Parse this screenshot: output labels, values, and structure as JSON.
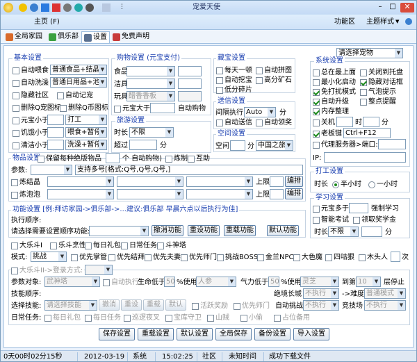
{
  "title": "宠爱天使",
  "menu": {
    "home": "主页 (F)",
    "function_area": "功能区",
    "theme": "主题样式",
    "theme_arrow": "▼"
  },
  "tabs": [
    "全局家园",
    "俱乐部",
    "设置",
    "免费声明"
  ],
  "basic": {
    "title": "基本设置",
    "auto_feed": "自动喂食",
    "feed_sel": "普通食品+结晶",
    "auto_wash": "自动洗澡",
    "wash_sel": "普通日用品+池",
    "hide_community": "隐藏社区",
    "auto_clean": "自动记宠",
    "del_qq_icon": "删除Q宠图标",
    "del_q_coin_icon": "删除Q币图标",
    "yuanbao_lt": "元宝小于",
    "yuanbao_sel": "打工",
    "hunger_lt": "饥饿小于",
    "hunger_sel": "喂食+暂停",
    "clean_lt": "清洁小于",
    "clean_sel": "洗澡+暂停"
  },
  "shop": {
    "title": "购物设置 (元宝支付)",
    "food": "食品",
    "clean": "洁具",
    "toy": "玩具",
    "toy_sel": "醋香香板",
    "yuanbao_gt": "元宝大于",
    "auto_buy": "自动购物"
  },
  "travel": {
    "title": "旅游设置",
    "duration": "时长",
    "duration_sel": "不限",
    "over": "超过",
    "minutes": "分"
  },
  "treasure": {
    "title": "藏宝设置",
    "daily": "每天一顿",
    "auto_puzzle": "自动拼图",
    "auto_dig": "自动挖宝",
    "high_ore": "高分矿石",
    "low_fragment": "低分碎片"
  },
  "gift": {
    "title": "送信设置",
    "interval": "间隔执行:",
    "interval_sel": "Auto",
    "min": "分",
    "auto_send": "自动送信",
    "auto_receive": "自动领奖"
  },
  "space": {
    "title": "空间设置",
    "space": "空间",
    "min": "分",
    "space_sel": "中国之旅"
  },
  "pet": {
    "select": "请选择宠物"
  },
  "sys": {
    "title": "系统设置",
    "topmost": "总在最上面",
    "close_tray": "关闭到托盘",
    "min_start": "最小化启动",
    "hide_dialog": "隐藏对话框",
    "free_mode": "免打扰模式",
    "bubble": "气泡提示",
    "auto_upgrade": "自动升级",
    "whole_hint": "整点提醒",
    "memory": "内存整理",
    "shutdown": "关机",
    "hour": "时",
    "minute": "分",
    "boss_key": "老板键",
    "boss_val": "Ctrl+F12",
    "proxy": "代理服务器>端口:",
    "ip": "IP:"
  },
  "work": {
    "title": "打工设置",
    "duration": "时长",
    "half_hour": "半小时",
    "one_hour": "一小时"
  },
  "study": {
    "title": "学习设置",
    "yuanbao_gt": "元宝多于",
    "force": "强制学习",
    "smart_exam": "智能考试",
    "take_fund": "领取奖学金",
    "duration": "时长",
    "duration_sel": "不限",
    "min": "分"
  },
  "items": {
    "title": "物品设置",
    "keep_each": "保留每种绝版物品",
    "count_suffix": "个 自动购物)",
    "refine": "炼制",
    "mutual": "互助",
    "param": "参数:",
    "param_hint": "支持多号[格式:Q号,Q号,Q号,]",
    "refine_crystal": "炼结晶",
    "refine_pool": "炼泡泡",
    "upper": "上限",
    "sort": "编排"
  },
  "func": {
    "title": "功能设置 [例:拜访家园->俱乐部->...建议:俱乐部 早晨六点以后执行为佳]",
    "exec_order": "执行顺序:",
    "choose": "请选择需要设置顺序功能:",
    "cancel": "撤消功能",
    "reset": "重设功能",
    "reload": "重载功能",
    "default": "默认功能"
  },
  "games": {
    "g1": "大乐斗I",
    "g2": "乐斗烹性",
    "g3": "每日礼包",
    "g4": "日常任务",
    "g5": "斗神塔",
    "mode": "模式:",
    "mode_sel": "挑战",
    "m1": "优先掌管",
    "m2": "优先结拜",
    "m3": "优先夫妻",
    "m4": "优先师门",
    "m5": "挑战BOSS",
    "m6": "金兰NPC",
    "m7": "大色魔",
    "m8": "四咕狠",
    "m9": "木头人",
    "m10": "次"
  },
  "fight": {
    "ii": "大乐斗II->登录方式:",
    "target": "参数对象:",
    "target_sel": "武神塔",
    "auto_exec": "自动执行",
    "hp_below": "生命低于",
    "hp_val": "50",
    "pct_use": "%使用",
    "hp_item": "人参",
    "qi_below": "气力低于",
    "qi_val": "50",
    "qi_item": "灵芝",
    "reach": "到第",
    "layer_val": "10",
    "stop": "层停止",
    "skill_order": "技能顺序:",
    "great_wall": "绝境长城",
    "not_exec": "不执行",
    "difficulty": "->难度",
    "diff_sel": "普通模式",
    "choose_skill": "选择技能:",
    "skill_sel": "请选择技能",
    "cancel": "撤消",
    "reset": "重设",
    "reload": "重载",
    "default": "默认",
    "active_reward": "活跃奖励",
    "master": "优先师门",
    "auto_challenge": "自动挑战",
    "not_exec2": "不执行",
    "arena": "竞技场",
    "not_exec3": "不执行",
    "daily": "日常任务:",
    "d1": "每日礼包",
    "d2": "每日任务",
    "d3": "巡逻夜叉",
    "d4": "宝库守卫",
    "d5": "山贼",
    "d6": "小偷",
    "d7": "占位备用"
  },
  "bottom": {
    "save": "保存设置",
    "reload": "重载设置",
    "default": "默认设置",
    "save_all": "全局保存",
    "backup": "备份设置",
    "import": "导入设置"
  },
  "status": {
    "runtime": "0天00时02分15秒",
    "date": "2012-03-19",
    "system": "系统",
    "time": "15:02:25",
    "community": "社区",
    "unknown": "未知时间",
    "download": "成功下载文件"
  },
  "colors": {
    "accent": "#1a3fb0",
    "frame": "#7b9ebd"
  }
}
